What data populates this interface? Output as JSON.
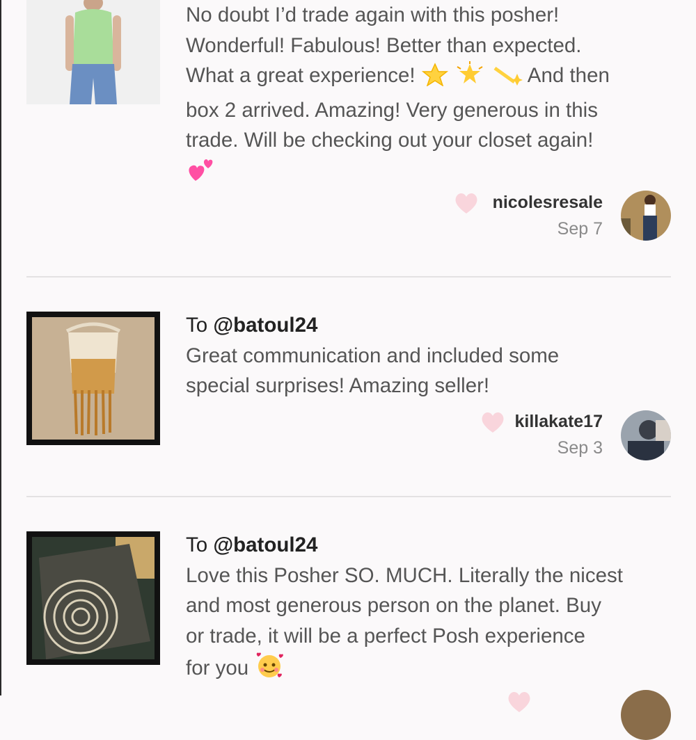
{
  "reviews": [
    {
      "lines": [
        "No doubt I’d trade again with this posher!",
        "Wonderful! Fabulous! Better than expected.",
        "What a great experience!",
        "And then",
        "box 2 arrived. Amazing! Very generous in this",
        "trade. Will be checking out your closet again!"
      ],
      "user": "nicolesresale",
      "date": "Sep 7"
    },
    {
      "to_prefix": "To ",
      "to_handle": "@batoul24",
      "lines": [
        "Great communication and included some",
        "special surprises! Amazing seller!"
      ],
      "user": "killakate17",
      "date": "Sep 3"
    },
    {
      "to_prefix": "To ",
      "to_handle": "@batoul24",
      "lines": [
        "Love this Posher SO. MUCH. Literally the nicest",
        "and most generous person on the planet. Buy",
        "or trade, it will be a perfect Posh experience",
        "for you"
      ]
    }
  ],
  "icons": {
    "like": "heart-icon",
    "star": "star-icon",
    "glowing_star": "glowing-star-icon",
    "dizzy": "dizzy-icon",
    "two_hearts": "two-hearts-icon",
    "smiling_hearts": "smiling-face-with-hearts-icon"
  },
  "colors": {
    "background": "#fbf9fa",
    "like_heart": "#f9d5dc",
    "divider": "#e3e1e2"
  }
}
